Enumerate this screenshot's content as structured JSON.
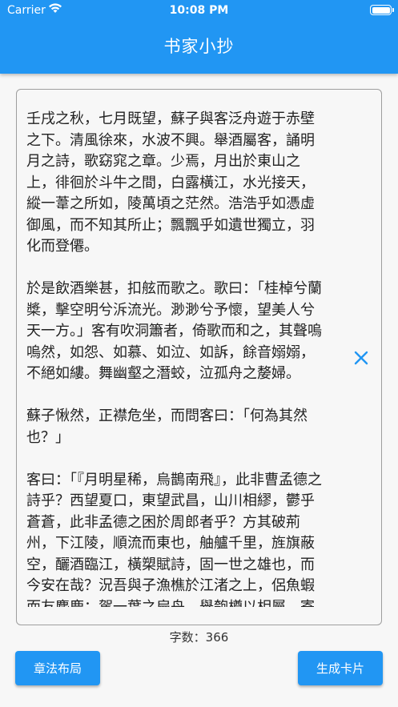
{
  "status_bar": {
    "carrier": "Carrier",
    "time": "10:08 PM"
  },
  "app_bar": {
    "title": "书家小抄",
    "color": "#2196f3"
  },
  "editor": {
    "text": "壬戌之秋，七月既望，蘇子與客泛舟遊于赤壁之下。清風徐來，水波不興。舉酒屬客，誦明月之詩，歌窈窕之章。少焉，月出於東山之上，徘徊於斗牛之間，白露橫江，水光接天，縱一葦之所如，陵萬頃之茫然。浩浩乎如憑虛御風，而不知其所止；飄飄乎如遺世獨立，羽化而登僊。\n\n於是飲酒樂甚，扣舷而歌之。歌曰：「桂棹兮蘭槳，擊空明兮泝流光。渺渺兮予懷，望美人兮天一方。」客有吹洞簫者，倚歌而和之，其聲嗚嗚然，如怨、如慕、如泣、如訴，餘音嫋嫋，不絕如縷。舞幽壑之潛蛟，泣孤舟之嫠婦。\n\n蘇子愀然，正襟危坐，而問客曰：「何為其然也？」\n\n客曰：「『月明星稀，烏鵲南飛』，此非曹孟德之詩乎？西望夏口，東望武昌，山川相繆，鬱乎蒼蒼，此非孟德之困於周郎者乎？方其破荊州，下江陵，順流而東也，舳艫千里，旌旗蔽空，釃酒臨江，橫槊賦詩，固一世之雄也，而今安在哉？況吾與子漁樵於江渚之上，侶魚蝦而友麋鹿；駕一葉之扁舟，舉匏樽以相屬。寄蜉蝣於天地，渺滄海之一粟。哀吾生之須臾，羨長江之無窮。挾飛仙以遨遊，抱明月而長終。知不可乎驟得，託遺響於悲風。」",
    "clear_icon": "close-icon"
  },
  "char_count": "字数：366",
  "buttons": {
    "layout": "章法布局",
    "generate": "生成卡片"
  }
}
